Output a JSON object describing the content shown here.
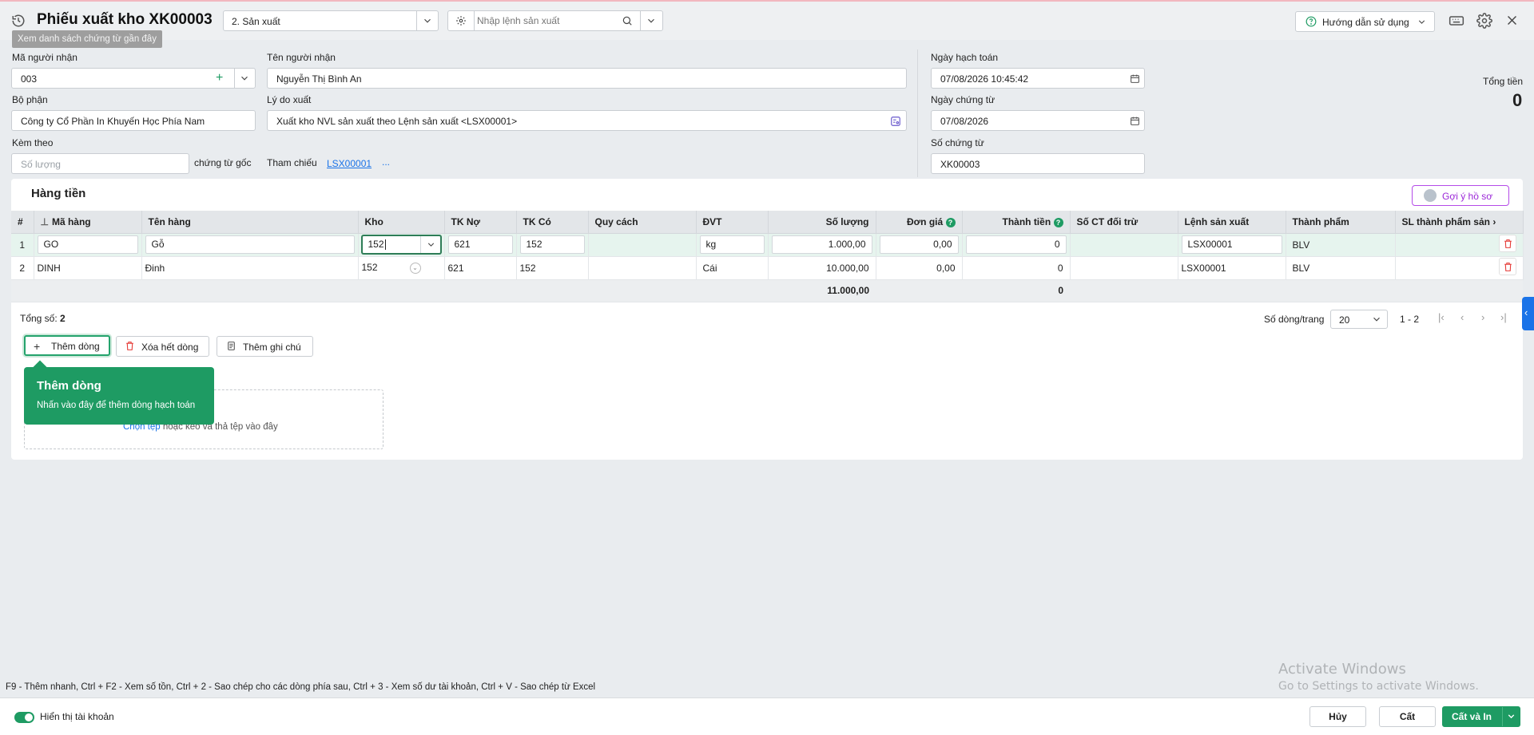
{
  "header": {
    "title": "Phiếu xuất kho XK00003",
    "history_tooltip": "Xem danh sách chứng từ gần đây",
    "type_select": "2. Sản xuất",
    "order_search_placeholder": "Nhập lệnh sản xuất",
    "guide_label": "Hướng dẫn sử dụng"
  },
  "form": {
    "recipient_code_label": "Mã người nhận",
    "recipient_code": "003",
    "recipient_name_label": "Tên người nhận",
    "recipient_name": "Nguyễn Thị Bình An",
    "department_label": "Bộ phận",
    "department": "Công ty Cổ Phần In Khuyến Học Phía Nam",
    "reason_label": "Lý do xuất",
    "reason": "Xuất kho NVL sản xuất theo Lệnh sản xuất <LSX00001>",
    "attach_label": "Kèm theo",
    "attach_placeholder": "Số lượng",
    "attach_suffix": "chứng từ gốc",
    "reference_label": "Tham chiếu",
    "reference_value": "LSX00001",
    "reference_more": "...",
    "posting_date_label": "Ngày hạch toán",
    "posting_date": "07/08/2026 10:45:42",
    "doc_date_label": "Ngày chứng từ",
    "doc_date": "07/08/2026",
    "doc_no_label": "Số chứng từ",
    "doc_no": "XK00003",
    "total_label": "Tổng tiền",
    "total_value": "0"
  },
  "grid": {
    "title": "Hàng tiền",
    "suggest_label": "Gợi ý hồ sơ",
    "columns": [
      "#",
      "Mã hàng",
      "Tên hàng",
      "Kho",
      "TK Nợ",
      "TK Có",
      "Quy cách",
      "ĐVT",
      "Số lượng",
      "Đơn giá",
      "Thành tiền",
      "Số CT đối trừ",
      "Lệnh sản xuất",
      "Thành phẩm",
      "SL thành phẩm sản"
    ],
    "rows": [
      {
        "no": "1",
        "code": "GO",
        "name": "Gỗ",
        "warehouse": "152",
        "debit": "621",
        "credit": "152",
        "spec": "",
        "unit": "kg",
        "qty": "1.000,00",
        "price": "0,00",
        "amount": "0",
        "offset_doc": "",
        "order": "LSX00001",
        "product": "BLV"
      },
      {
        "no": "2",
        "code": "DINH",
        "name": "Đinh",
        "warehouse": "152",
        "debit": "621",
        "credit": "152",
        "spec": "",
        "unit": "Cái",
        "qty": "10.000,00",
        "price": "0,00",
        "amount": "0",
        "offset_doc": "",
        "order": "LSX00001",
        "product": "BLV"
      }
    ],
    "totals": {
      "qty": "11.000,00",
      "amount": "0"
    },
    "count_label": "Tổng số:",
    "count_value": "2",
    "page_size_label": "Số dòng/trang",
    "page_size": "20",
    "page_range": "1 - 2",
    "add_row_label": "Thêm dòng",
    "delete_all_label": "Xóa hết dòng",
    "add_note_label": "Thêm ghi chú",
    "tip_title": "Thêm dòng",
    "tip_desc": "Nhấn vào đây để thêm dòng hạch toán",
    "drop_link": "Chọn tệp",
    "drop_text": "hoặc kéo và thả tệp vào đây"
  },
  "footer": {
    "hint": "F9 - Thêm nhanh, Ctrl + F2 - Xem số tồn, Ctrl + 2 - Sao chép cho các dòng phía sau, Ctrl + 3 - Xem số dư tài khoản, Ctrl + V - Sao chép từ Excel",
    "toggle_label": "Hiển thị tài khoản",
    "cancel_label": "Hủy",
    "save_label": "Cất",
    "save_print_label": "Cất và In"
  },
  "watermark": {
    "title": "Activate Windows",
    "subtitle": "Go to Settings to activate Windows."
  },
  "colors": {
    "accent": "#1e9b63",
    "link": "#1a73e8",
    "suggest": "#9b27d8",
    "delete": "#e53935"
  }
}
